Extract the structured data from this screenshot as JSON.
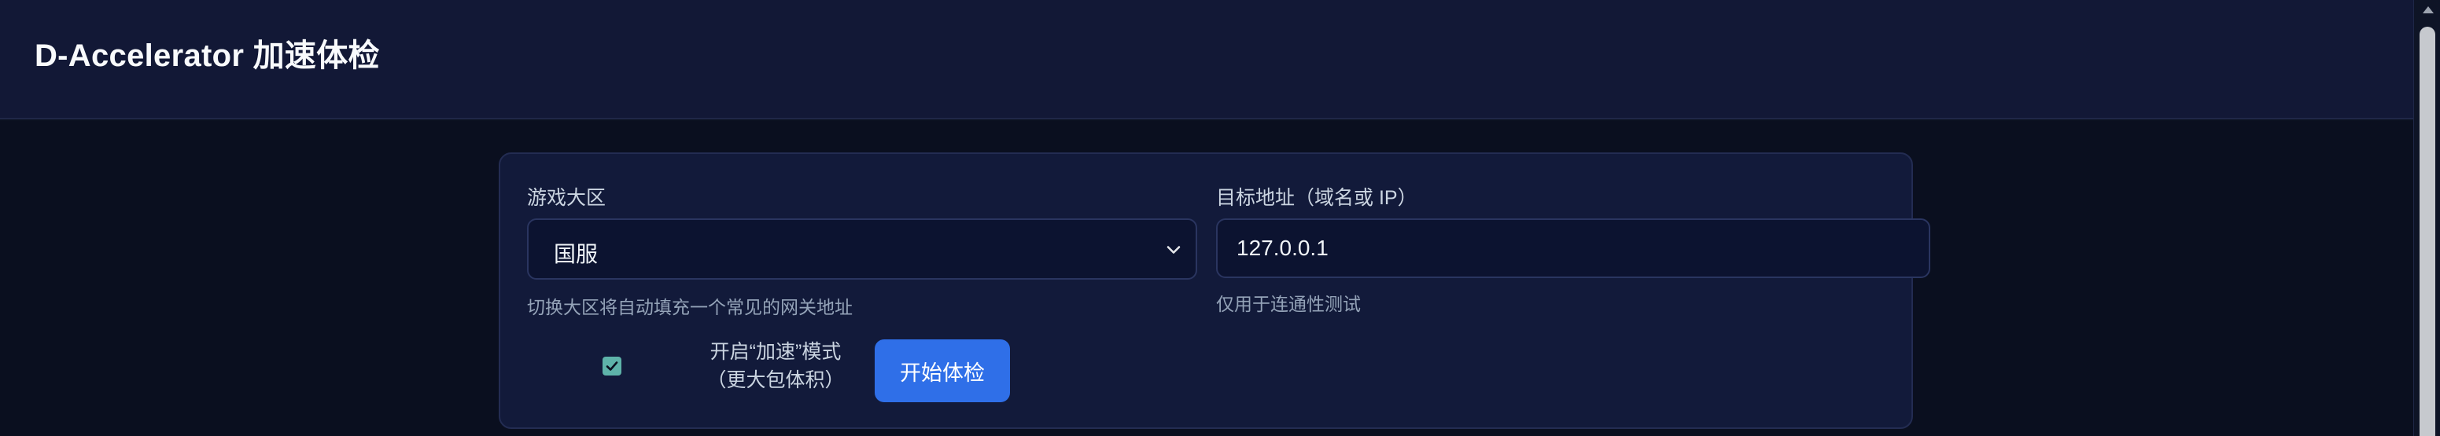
{
  "header": {
    "title": "D-Accelerator 加速体检"
  },
  "form": {
    "region": {
      "label": "游戏大区",
      "value": "国服",
      "hint": "切换大区将自动填充一个常见的网关地址"
    },
    "target": {
      "label": "目标地址（域名或 IP）",
      "value": "127.0.0.1",
      "hint": "仅用于连通性测试"
    },
    "accel_mode": {
      "checked": true,
      "label_line1": "开启“加速”模式",
      "label_line2": "（更大包体积）"
    },
    "start_button_label": "开始体检"
  },
  "colors": {
    "header_bg": "#121836",
    "page_bg": "#0a0f1f",
    "card_bg": "#121a3a",
    "button_bg": "#2f6fe8",
    "checkbox_accent": "#5eb3a9"
  },
  "icons": {
    "select_chevron": "chevron-down-icon",
    "checkbox_check": "check-icon"
  }
}
